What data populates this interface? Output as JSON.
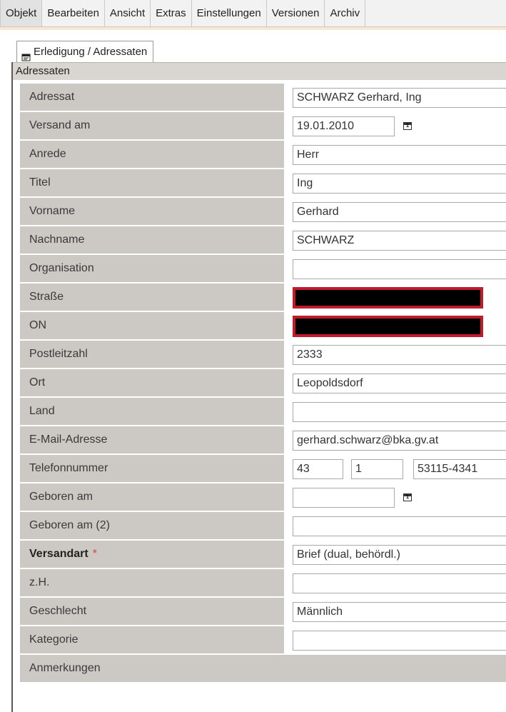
{
  "menu": [
    "Objekt",
    "Bearbeiten",
    "Ansicht",
    "Extras",
    "Einstellungen",
    "Versionen",
    "Archiv"
  ],
  "tab": {
    "label": "Erledigung / Adressaten",
    "icon": "form-icon"
  },
  "section": {
    "title": "Adressaten"
  },
  "fields": {
    "adressat": {
      "label": "Adressat",
      "value": "SCHWARZ Gerhard, Ing"
    },
    "versand_am": {
      "label": "Versand am",
      "value": "19.01.2010"
    },
    "anrede": {
      "label": "Anrede",
      "value": "Herr"
    },
    "titel": {
      "label": "Titel",
      "value": "Ing"
    },
    "vorname": {
      "label": "Vorname",
      "value": "Gerhard"
    },
    "nachname": {
      "label": "Nachname",
      "value": "SCHWARZ"
    },
    "organisation": {
      "label": "Organisation",
      "value": ""
    },
    "strasse": {
      "label": "Straße",
      "value": ""
    },
    "on": {
      "label": "ON",
      "value": ""
    },
    "postleitzahl": {
      "label": "Postleitzahl",
      "value": "2333"
    },
    "ort": {
      "label": "Ort",
      "value": "Leopoldsdorf"
    },
    "land": {
      "label": "Land",
      "value": ""
    },
    "email": {
      "label": "E-Mail-Adresse",
      "value": "gerhard.schwarz@bka.gv.at"
    },
    "telefon": {
      "label": "Telefonnummer",
      "country": "43",
      "area": "1",
      "number": "53115-4341"
    },
    "geboren_am": {
      "label": "Geboren am",
      "value": ""
    },
    "geboren_am_2": {
      "label": "Geboren am (2)",
      "value": ""
    },
    "versandart": {
      "label": "Versandart",
      "required_mark": "*",
      "value": "Brief (dual, behördl.)"
    },
    "zh": {
      "label": "z.H.",
      "value": ""
    },
    "geschlecht": {
      "label": "Geschlecht",
      "value": "Männlich"
    },
    "kategorie": {
      "label": "Kategorie",
      "value": ""
    },
    "anmerkungen": {
      "label": "Anmerkungen"
    }
  },
  "colors": {
    "label_bg": "#ccc8c3",
    "redaction_border": "#c11a2a",
    "required": "#e04040"
  }
}
